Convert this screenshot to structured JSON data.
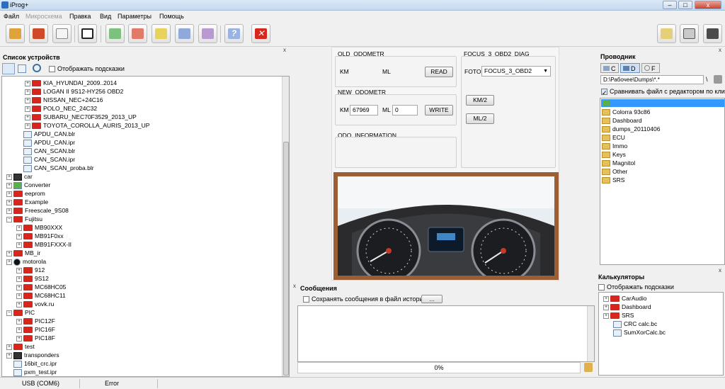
{
  "window": {
    "title": "iProg+",
    "min": "–",
    "max": "□",
    "close": "x"
  },
  "menu": [
    "Файл",
    "Микросхема",
    "Правка",
    "Вид",
    "Параметры",
    "Помощь"
  ],
  "device_panel": {
    "title": "Список устройств",
    "show_hints": "Отображать подсказки",
    "close": "x",
    "tree": [
      {
        "label": "KIA_HYUNDAI_2009..2014",
        "indent": 2,
        "kind": "folder"
      },
      {
        "label": "LOGAN II 9S12-HY256 OBD2",
        "indent": 2,
        "kind": "folder"
      },
      {
        "label": "NISSAN_NEC+24C16",
        "indent": 2,
        "kind": "folder"
      },
      {
        "label": "POLO_NEC_24C32",
        "indent": 2,
        "kind": "folder"
      },
      {
        "label": "SUBARU_NEC70F3529_2013_UP",
        "indent": 2,
        "kind": "folder"
      },
      {
        "label": "TOYOTA_COROLLA_AURIS_2013_UP",
        "indent": 2,
        "kind": "folder"
      },
      {
        "label": "APDU_CAN.blr",
        "indent": 1,
        "kind": "file"
      },
      {
        "label": "APDU_CAN.ipr",
        "indent": 1,
        "kind": "file"
      },
      {
        "label": "CAN_SCAN.blr",
        "indent": 1,
        "kind": "file"
      },
      {
        "label": "CAN_SCAN.ipr",
        "indent": 1,
        "kind": "file"
      },
      {
        "label": "CAN_SCAN_proba.blr",
        "indent": 1,
        "kind": "file"
      },
      {
        "label": "car",
        "indent": 0,
        "kind": "car"
      },
      {
        "label": "Converter",
        "indent": 0,
        "kind": "green"
      },
      {
        "label": "eeprom",
        "indent": 0,
        "kind": "folder"
      },
      {
        "label": "Example",
        "indent": 0,
        "kind": "folder"
      },
      {
        "label": "Freescale_9S08",
        "indent": 0,
        "kind": "folder"
      },
      {
        "label": "Fujitsu",
        "indent": 0,
        "kind": "open"
      },
      {
        "label": "MB90XXX",
        "indent": 1,
        "kind": "folder"
      },
      {
        "label": "MB91F0xx",
        "indent": 1,
        "kind": "folder"
      },
      {
        "label": "MB91FXXX-II",
        "indent": 1,
        "kind": "folder"
      },
      {
        "label": "MB_ir",
        "indent": 0,
        "kind": "folder"
      },
      {
        "label": "motorola",
        "indent": 0,
        "kind": "moto"
      },
      {
        "label": "912",
        "indent": 1,
        "kind": "folder"
      },
      {
        "label": "9S12",
        "indent": 1,
        "kind": "folder"
      },
      {
        "label": "MC68HC05",
        "indent": 1,
        "kind": "folder"
      },
      {
        "label": "MC68HC11",
        "indent": 1,
        "kind": "folder"
      },
      {
        "label": "vovk.ru",
        "indent": 1,
        "kind": "folder"
      },
      {
        "label": "PIC",
        "indent": 0,
        "kind": "open"
      },
      {
        "label": "PIC12F",
        "indent": 1,
        "kind": "folder"
      },
      {
        "label": "PIC16F",
        "indent": 1,
        "kind": "folder"
      },
      {
        "label": "PIC18F",
        "indent": 1,
        "kind": "folder"
      },
      {
        "label": "test",
        "indent": 0,
        "kind": "folder"
      },
      {
        "label": "transponders",
        "indent": 0,
        "kind": "car"
      },
      {
        "label": "16bit_crc.ipr",
        "indent": 0,
        "kind": "file"
      },
      {
        "label": "pxm_test.ipr",
        "indent": 0,
        "kind": "file"
      }
    ]
  },
  "script_form": {
    "old_odo": {
      "title": "OLD_ODOMETR",
      "km": "KM",
      "ml": "ML",
      "read": "READ"
    },
    "new_odo": {
      "title": "NEW_ODOMETR",
      "km": "KM",
      "km_value": "67969",
      "ml": "ML",
      "ml_value": "0",
      "write": "WRITE"
    },
    "odo_info": {
      "title": "ODO_INFORMATION"
    },
    "diag": {
      "title": "FOCUS_3_OBD2_DIAG",
      "foto_label": "FOTO",
      "foto_value": "FOCUS_3_OBD2",
      "km2": "KM/2",
      "ml2": "ML/2"
    }
  },
  "messages": {
    "title": "Сообщения",
    "save_history": "Сохранять сообщения в файл истории",
    "browse": "...",
    "progress": "0%",
    "close": "x"
  },
  "explorer": {
    "title": "Проводник",
    "drives": [
      "C",
      "D",
      "F"
    ],
    "path": "D:\\Рабочее\\Dumps\\*.*",
    "path_sep": "\\",
    "compare": "Сравнивать файл с редактором по клику м",
    "folders": [
      "Colorra 93c86",
      "Dashboard",
      "dumps_20110406",
      "ECU",
      "Immo",
      "Keys",
      "Magnitol",
      "Other",
      "SRS"
    ],
    "close": "x"
  },
  "calculators": {
    "title": "Калькуляторы",
    "show_hints": "Отображать подсказки",
    "items": [
      {
        "label": "CarAudio",
        "kind": "folder"
      },
      {
        "label": "Dashboard",
        "kind": "folder"
      },
      {
        "label": "SRS",
        "kind": "folder"
      },
      {
        "label": "CRC calc.bc",
        "kind": "calc"
      },
      {
        "label": "SumXorCalc.bc",
        "kind": "calc"
      }
    ],
    "close": "x"
  },
  "statusbar": {
    "port": "USB (COM6)",
    "state": "Error"
  },
  "colors": {
    "accent": "#d7261e",
    "selection": "#3399ff"
  }
}
